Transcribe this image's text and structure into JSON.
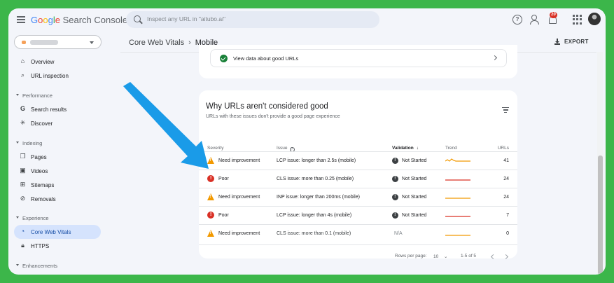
{
  "app": {
    "logo_parts": [
      "G",
      "o",
      "o",
      "g",
      "l",
      "e"
    ],
    "logo_rest": " Search Console",
    "search_placeholder": "Inspect any URL in \"aitubo.ai\"",
    "notification_count": "20"
  },
  "sidebar": {
    "items": [
      {
        "label": "Overview",
        "icon": "home-icon"
      },
      {
        "label": "URL inspection",
        "icon": "search-icon"
      }
    ],
    "sections": [
      {
        "label": "Performance",
        "items": [
          {
            "label": "Search results",
            "icon": "google-g-icon"
          },
          {
            "label": "Discover",
            "icon": "asterisk-icon"
          }
        ]
      },
      {
        "label": "Indexing",
        "items": [
          {
            "label": "Pages",
            "icon": "pages-icon"
          },
          {
            "label": "Videos",
            "icon": "videos-icon"
          },
          {
            "label": "Sitemaps",
            "icon": "sitemap-icon"
          },
          {
            "label": "Removals",
            "icon": "removals-icon"
          }
        ]
      },
      {
        "label": "Experience",
        "items": [
          {
            "label": "Core Web Vitals",
            "icon": "gauge-icon",
            "active": true
          },
          {
            "label": "HTTPS",
            "icon": "lock-icon"
          }
        ]
      },
      {
        "label": "Enhancements",
        "items": []
      }
    ]
  },
  "header": {
    "breadcrumb_parent": "Core Web Vitals",
    "breadcrumb_current": "Mobile",
    "export_label": "EXPORT"
  },
  "good_urls": {
    "label": "View data about good URLs"
  },
  "issues_card": {
    "title": "Why URLs aren't considered good",
    "subtitle": "URLs with these issues don't provide a good page experience",
    "columns": {
      "severity": "Severity",
      "issue": "Issue",
      "validation": "Validation",
      "trend": "Trend",
      "urls": "URLs"
    },
    "rows": [
      {
        "severity": "Need improvement",
        "level": "warn",
        "issue": "LCP issue: longer than 2.5s (mobile)",
        "bold": true,
        "validation": "Not Started",
        "trend_color": "#f29900",
        "urls": "41"
      },
      {
        "severity": "Poor",
        "level": "poor",
        "issue": "CLS issue: more than 0.25 (mobile)",
        "bold": true,
        "validation": "Not Started",
        "trend_color": "#d93025",
        "urls": "24"
      },
      {
        "severity": "Need improvement",
        "level": "warn",
        "issue": "INP issue: longer than 200ms (mobile)",
        "bold": true,
        "validation": "Not Started",
        "trend_color": "#f29900",
        "urls": "24"
      },
      {
        "severity": "Poor",
        "level": "poor",
        "issue": "LCP issue: longer than 4s (mobile)",
        "bold": true,
        "validation": "Not Started",
        "trend_color": "#d93025",
        "urls": "7"
      },
      {
        "severity": "Need improvement",
        "level": "warn",
        "issue": "CLS issue: more than 0.1 (mobile)",
        "bold": false,
        "validation": "N/A",
        "trend_color": "#f29900",
        "urls": "0"
      }
    ],
    "pagination": {
      "rows_per_page_label": "Rows per page:",
      "rows_per_page": "10",
      "range": "1-5 of 5"
    }
  },
  "colors": {
    "frame_border": "#3cb64a",
    "arrow": "#1a9be8",
    "active_nav": "#d5e3fd"
  }
}
